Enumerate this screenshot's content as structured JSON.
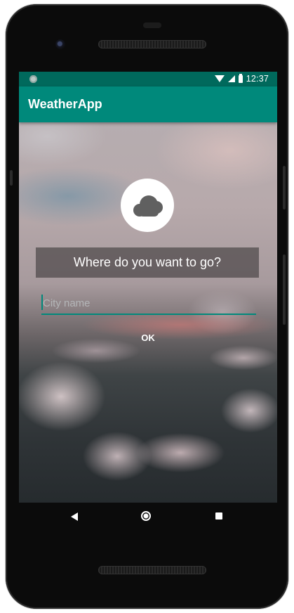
{
  "status_bar": {
    "time": "12:37",
    "icons": [
      "notification-dot-icon",
      "wifi-icon",
      "signal-icon",
      "battery-icon"
    ]
  },
  "app_bar": {
    "title": "WeatherApp",
    "background": "#00897b",
    "status_background": "#00695c"
  },
  "main": {
    "logo_icon": "cloud-icon",
    "prompt": "Where do you want to go?",
    "city_input": {
      "value": "",
      "placeholder": "City name"
    },
    "ok_label": "OK"
  },
  "nav_bar": {
    "icons": [
      "back-icon",
      "home-icon",
      "recents-icon"
    ]
  }
}
